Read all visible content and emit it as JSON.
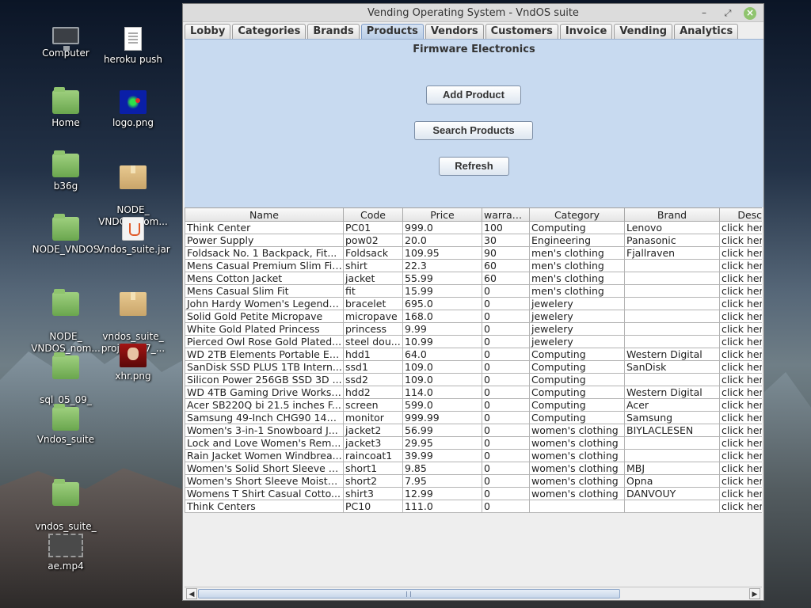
{
  "desktop": {
    "icons": [
      {
        "label": "Computer",
        "icon": "computer-icon"
      },
      {
        "label": "heroku push",
        "icon": "text-file-icon"
      },
      {
        "label": "Home",
        "icon": "home-folder-icon"
      },
      {
        "label": "logo.png",
        "icon": "image-file-icon"
      },
      {
        "label": "b36g",
        "icon": "folder-icon"
      },
      {
        "label": "NODE_\nVNDOS_nom...",
        "icon": "archive-icon"
      },
      {
        "label": "NODE_VNDOS",
        "icon": "folder-icon"
      },
      {
        "label": "Vndos_suite.jar",
        "icon": "java-jar-icon"
      },
      {
        "label": "NODE_\nVNDOS_nom...",
        "icon": "folder-icon"
      },
      {
        "label": "vndos_suite_\nproject_07_...",
        "icon": "archive-icon"
      },
      {
        "label": "sql_05_09_\n2022",
        "icon": "folder-icon"
      },
      {
        "label": "xhr.png",
        "icon": "image-file-icon"
      },
      {
        "label": "Vndos_suite",
        "icon": "folder-icon"
      },
      {
        "label": "vndos_suite_\nproject",
        "icon": "folder-icon"
      },
      {
        "label": "ae.mp4",
        "icon": "video-file-icon"
      }
    ]
  },
  "window": {
    "title": "Vending Operating System - VndOS suite",
    "controls": {
      "minimize": "–",
      "maximize": "⤢",
      "close": "×"
    },
    "tabs": [
      {
        "label": "Lobby",
        "active": false
      },
      {
        "label": "Categories",
        "active": false
      },
      {
        "label": "Brands",
        "active": false
      },
      {
        "label": "Products",
        "active": true
      },
      {
        "label": "Vendors",
        "active": false
      },
      {
        "label": "Customers",
        "active": false
      },
      {
        "label": "Invoice",
        "active": false
      },
      {
        "label": "Vending",
        "active": false
      },
      {
        "label": "Analytics",
        "active": false
      }
    ]
  },
  "panel": {
    "title": "Firmware Electronics",
    "buttons": {
      "add": "Add Product",
      "search": "Search Products",
      "refresh": "Refresh"
    }
  },
  "table": {
    "columns": [
      "Name",
      "Code",
      "Price",
      "warran...",
      "Category",
      "Brand",
      "Descri"
    ],
    "rows": [
      [
        "Think Center",
        "PC01",
        "999.0",
        "100",
        "Computing",
        "Lenovo",
        "click her"
      ],
      [
        "Power Supply",
        "pow02",
        "20.0",
        "30",
        "Engineering",
        "Panasonic",
        "click her"
      ],
      [
        "Foldsack No. 1 Backpack, Fit...",
        "Foldsack",
        "109.95",
        "90",
        "men's clothing",
        "Fjallraven",
        "click her"
      ],
      [
        "Mens Casual Premium Slim Fit...",
        "shirt",
        "22.3",
        "60",
        "men's clothing",
        "",
        "click her"
      ],
      [
        "Mens Cotton Jacket",
        "jacket",
        "55.99",
        "60",
        "men's clothing",
        "",
        "click her"
      ],
      [
        "Mens Casual Slim Fit",
        "fit",
        "15.99",
        "0",
        "men's clothing",
        "",
        "click her"
      ],
      [
        "John Hardy Women's Legends...",
        "bracelet",
        "695.0",
        "0",
        "jewelery",
        "",
        "click her"
      ],
      [
        "Solid Gold Petite Micropave",
        "micropave",
        "168.0",
        "0",
        "jewelery",
        "",
        "click her"
      ],
      [
        "White Gold Plated Princess",
        "princess",
        "9.99",
        "0",
        "jewelery",
        "",
        "click her"
      ],
      [
        "Pierced Owl Rose Gold Plated...",
        "steel dou...",
        "10.99",
        "0",
        "jewelery",
        "",
        "click her"
      ],
      [
        "WD 2TB Elements Portable Ex...",
        "hdd1",
        "64.0",
        "0",
        "Computing",
        "Western Digital",
        "click her"
      ],
      [
        "SanDisk SSD PLUS 1TB Intern...",
        "ssd1",
        "109.0",
        "0",
        "Computing",
        "SanDisk",
        "click her"
      ],
      [
        "Silicon Power 256GB SSD 3D ...",
        "ssd2",
        "109.0",
        "0",
        "Computing",
        "",
        "click her"
      ],
      [
        "WD 4TB Gaming Drive Works ...",
        "hdd2",
        "114.0",
        "0",
        "Computing",
        "Western Digital",
        "click her"
      ],
      [
        "Acer SB220Q bi 21.5 inches F...",
        "screen",
        "599.0",
        "0",
        "Computing",
        "Acer",
        "click her"
      ],
      [
        "Samsung 49-Inch CHG90 144...",
        "monitor",
        "999.99",
        "0",
        "Computing",
        "Samsung",
        "click her"
      ],
      [
        " Women's 3-in-1 Snowboard J...",
        "jacket2",
        "56.99",
        "0",
        "women's clothing",
        "BIYLACLESEN",
        "click her"
      ],
      [
        "Lock and Love Women's Rem...",
        "jacket3",
        "29.95",
        "0",
        "women's clothing",
        "",
        "click her"
      ],
      [
        "Rain Jacket Women Windbrea...",
        "raincoat1",
        "39.99",
        "0",
        "women's clothing",
        "",
        "click her"
      ],
      [
        "Women's Solid Short Sleeve B...",
        "short1",
        "9.85",
        "0",
        "women's clothing",
        "MBJ",
        "click her"
      ],
      [
        "Women's Short Sleeve Moisture",
        "short2",
        "7.95",
        "0",
        "women's clothing",
        "Opna",
        "click her"
      ],
      [
        "Womens T Shirt Casual Cotto...",
        "shirt3",
        "12.99",
        "0",
        "women's clothing",
        "DANVOUY",
        "click her"
      ],
      [
        "Think Centers",
        "PC10",
        "111.0",
        "0",
        "",
        "",
        "click her"
      ]
    ]
  },
  "scrollbar": {
    "left_arrow": "◀",
    "right_arrow": "▶"
  }
}
